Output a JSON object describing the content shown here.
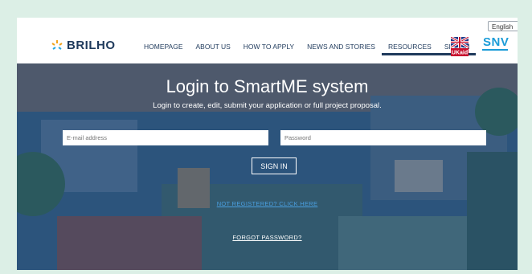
{
  "header": {
    "language_selector": "English",
    "logo_text": "BRILHO",
    "nav": [
      {
        "label": "HOMEPAGE"
      },
      {
        "label": "ABOUT US"
      },
      {
        "label": "HOW TO APPLY"
      },
      {
        "label": "NEWS AND STORIES"
      },
      {
        "label": "RESOURCES"
      },
      {
        "label": "SIGN IN"
      }
    ],
    "partner_logos": [
      "UKaid",
      "SNV"
    ],
    "snv_text": "SNV",
    "ukaid_text": "UKaid"
  },
  "hero": {
    "title": "Login to SmartME system",
    "subtitle": "Login to create, edit, submit your application or full project proposal.",
    "email_placeholder": "E-mail address",
    "password_placeholder": "Password",
    "signin_label": "SIGN IN",
    "register_link": "NOT REGISTERED? CLICK HERE",
    "forgot_link": "FORGOT PASSWORD?"
  },
  "colors": {
    "brand_navy": "#1f3a5c",
    "snv_blue": "#1b9cd8",
    "overlay": "#1e3e6e",
    "link_blue": "#4a9fe0"
  }
}
